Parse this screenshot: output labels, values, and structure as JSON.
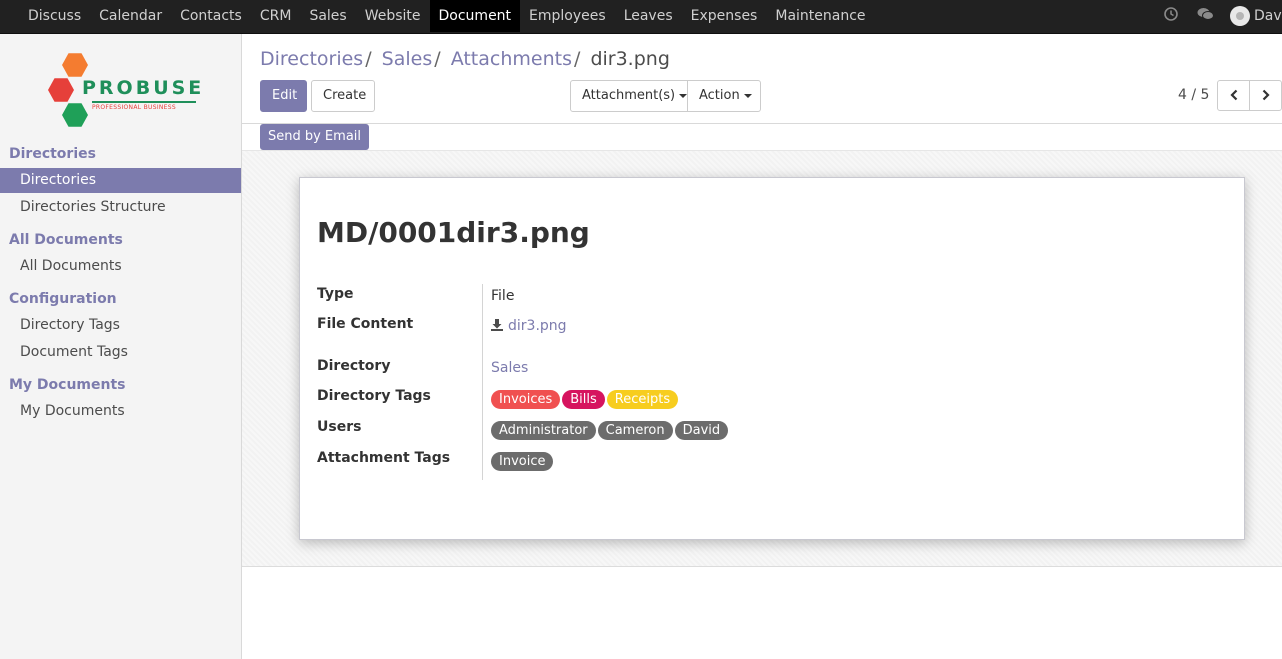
{
  "topbar": {
    "menu": [
      "Discuss",
      "Calendar",
      "Contacts",
      "CRM",
      "Sales",
      "Website",
      "Document",
      "Employees",
      "Leaves",
      "Expenses",
      "Maintenance"
    ],
    "active": "Document",
    "user_name": "David"
  },
  "logo": {
    "word": "PROBUSE",
    "tagline": "PROFESSIONAL BUSINESS"
  },
  "sidebar": {
    "sections": [
      {
        "title": "Directories",
        "items": [
          "Directories",
          "Directories Structure"
        ]
      },
      {
        "title": "All Documents",
        "items": [
          "All Documents"
        ]
      },
      {
        "title": "Configuration",
        "items": [
          "Directory Tags",
          "Document Tags"
        ]
      },
      {
        "title": "My Documents",
        "items": [
          "My Documents"
        ]
      }
    ],
    "active_item": "Directories"
  },
  "breadcrumb": {
    "items": [
      "Directories",
      "Sales",
      "Attachments"
    ],
    "current": "dir3.png"
  },
  "buttons": {
    "edit": "Edit",
    "create": "Create",
    "attachments": "Attachment(s)",
    "action": "Action",
    "send_email": "Send by Email"
  },
  "pager": {
    "value": "4 / 5"
  },
  "record": {
    "title": "MD/0001dir3.png",
    "labels": {
      "type": "Type",
      "file_content": "File Content",
      "directory": "Directory",
      "directory_tags": "Directory Tags",
      "users": "Users",
      "attachment_tags": "Attachment Tags"
    },
    "type": "File",
    "file_content": "dir3.png",
    "directory": "Sales",
    "directory_tags": [
      {
        "label": "Invoices",
        "color": "#f05050"
      },
      {
        "label": "Bills",
        "color": "#d6145f"
      },
      {
        "label": "Receipts",
        "color": "#f7cd1f"
      }
    ],
    "users": [
      {
        "label": "Administrator",
        "color": "#6c6c6c"
      },
      {
        "label": "Cameron",
        "color": "#6c6c6c"
      },
      {
        "label": "David",
        "color": "#6c6c6c"
      }
    ],
    "attachment_tags": [
      {
        "label": "Invoice",
        "color": "#6c6c6c"
      }
    ]
  },
  "colors": {
    "accent": "#7c7bad",
    "navbar": "#212121"
  }
}
